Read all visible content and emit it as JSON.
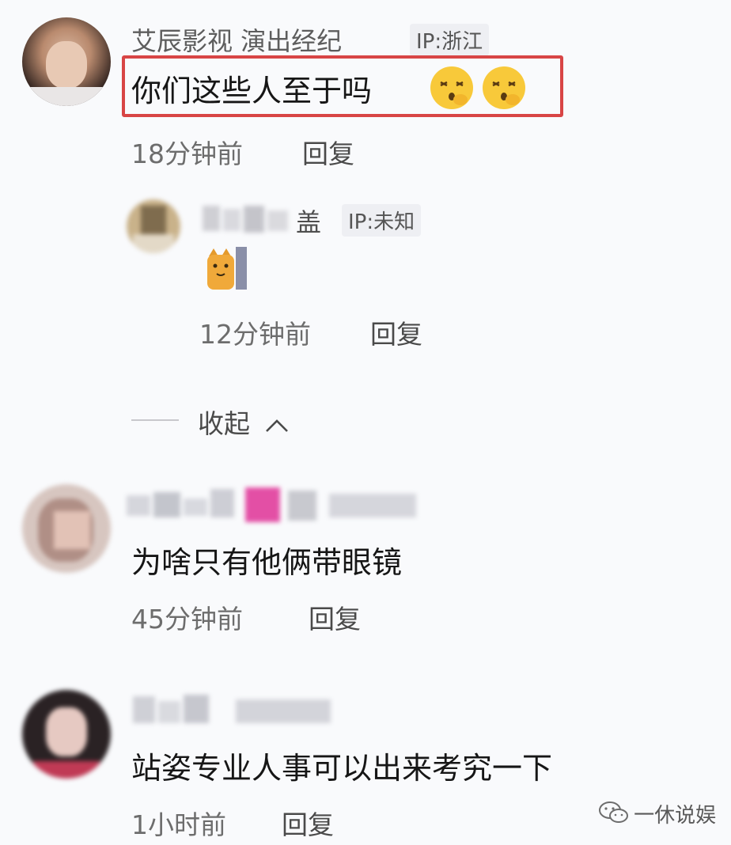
{
  "comments": [
    {
      "name": "艾辰影视 演出经纪",
      "ip": "IP:浙江",
      "text": "你们这些人至于吗",
      "time": "18分钟前",
      "reply": "回复",
      "emojis": [
        "hushed-face-icon",
        "hushed-face-icon"
      ]
    },
    {
      "name_visible": "盖",
      "ip": "IP:未知",
      "time": "12分钟前",
      "reply": "回复",
      "sticker": "cat-sticker-icon"
    },
    {
      "text": "为啥只有他俩带眼镜",
      "time": "45分钟前",
      "reply": "回复"
    },
    {
      "text": "站姿专业人事可以出来考究一下",
      "time": "1小时前",
      "reply": "回复"
    }
  ],
  "collapse": {
    "label": "收起",
    "icon": "chevron-up-icon"
  },
  "watermark": {
    "label": "一休说娱",
    "icon": "wechat-icon"
  },
  "colors": {
    "highlight_border": "#d84545",
    "name_gray": "#5d5d5d",
    "time_gray": "#6d6d6d"
  }
}
